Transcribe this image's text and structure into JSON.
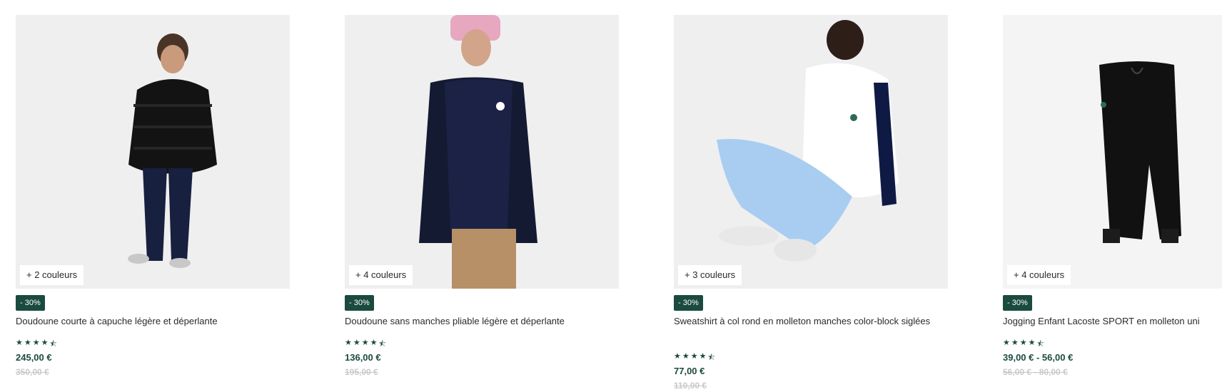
{
  "products": [
    {
      "colors_label": "+ 2 couleurs",
      "discount": "- 30%",
      "title": "Doudoune courte à capuche légère et déperlante",
      "rating": 4.5,
      "price": "245,00 €",
      "old_price": "350,00 €"
    },
    {
      "colors_label": "+ 4 couleurs",
      "discount": "- 30%",
      "title": "Doudoune sans manches pliable légère et déperlante",
      "rating": 4.5,
      "price": "136,00 €",
      "old_price": "195,00 €"
    },
    {
      "colors_label": "+ 3 couleurs",
      "discount": "- 30%",
      "title": "Sweatshirt à col rond en molleton manches color-block siglées",
      "rating": 4.5,
      "price": "77,00 €",
      "old_price": "110,00 €"
    },
    {
      "colors_label": "+ 4 couleurs",
      "discount": "- 30%",
      "title": "Jogging Enfant Lacoste SPORT en molleton uni",
      "rating": 4.5,
      "price": "39,00 € - 56,00 €",
      "old_price": "56,00 € - 80,00 €"
    }
  ],
  "colors": {
    "accent": "#1b4a3f",
    "old_price": "#c9c9c9",
    "image_bg": "#efeff0"
  }
}
